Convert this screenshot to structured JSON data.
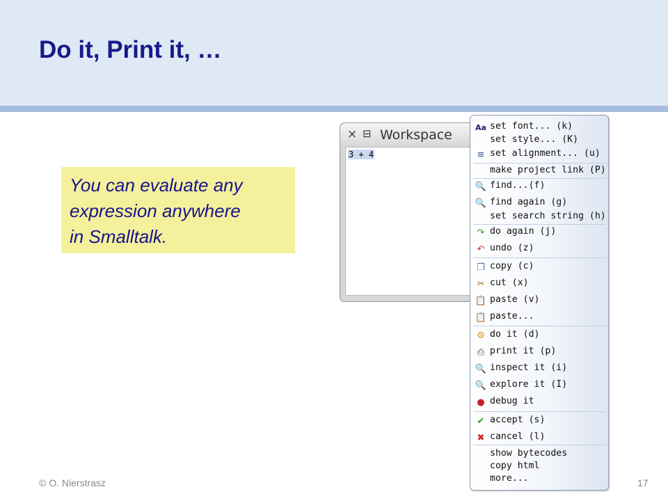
{
  "slide": {
    "title": "Do it, Print it, …",
    "callout": [
      "You can evaluate any",
      "expression anywhere",
      "in Smalltalk."
    ],
    "footer_left": "© O. Nierstrasz",
    "page_number": "17"
  },
  "workspace": {
    "close_glyph": "×",
    "menu_glyph": "⊟",
    "title": "Workspace",
    "code": "3 + 4"
  },
  "menu": {
    "items": [
      {
        "label": "set font... (k)",
        "icon": "font-icon"
      },
      {
        "label": "set style... (K)",
        "icon": ""
      },
      {
        "label": "set alignment... (u)",
        "icon": "align-icon"
      },
      {
        "label": "make project link (P)",
        "icon": ""
      },
      {
        "label": "find...(f)",
        "icon": "find-icon"
      },
      {
        "label": "find again (g)",
        "icon": "find-icon"
      },
      {
        "label": "set search string (h)",
        "icon": ""
      },
      {
        "label": "do again (j)",
        "icon": "redo-icon"
      },
      {
        "label": "undo (z)",
        "icon": "undo-icon"
      },
      {
        "label": "copy (c)",
        "icon": "copy-icon"
      },
      {
        "label": "cut (x)",
        "icon": "scissors-icon"
      },
      {
        "label": "paste (v)",
        "icon": "clipboard-icon"
      },
      {
        "label": "paste...",
        "icon": "clipboard-icon"
      },
      {
        "label": "do it (d)",
        "icon": "gear-icon"
      },
      {
        "label": "print it (p)",
        "icon": "printer-icon"
      },
      {
        "label": "inspect it (i)",
        "icon": "magnifier-icon"
      },
      {
        "label": "explore it (I)",
        "icon": "magnifier-icon"
      },
      {
        "label": "debug it",
        "icon": "bug-icon"
      },
      {
        "label": "accept (s)",
        "icon": "checkmark-icon"
      },
      {
        "label": "cancel (l)",
        "icon": "cross-icon"
      },
      {
        "label": "show bytecodes",
        "icon": ""
      },
      {
        "label": "copy html",
        "icon": ""
      },
      {
        "label": "more...",
        "icon": ""
      }
    ]
  },
  "icon_glyphs": {
    "font-icon": "Aa",
    "align-icon": "≡",
    "find-icon": "🔍",
    "redo-icon": "↷",
    "undo-icon": "↶",
    "copy-icon": "❐",
    "scissors-icon": "✂",
    "clipboard-icon": "📋",
    "gear-icon": "⚙",
    "printer-icon": "⎙",
    "magnifier-icon": "🔍",
    "bug-icon": "●",
    "checkmark-icon": "✔",
    "cross-icon": "✖"
  },
  "colors": {
    "title": "#161a88",
    "callout_bg": "#f5f09c",
    "header_bg": "#dfe8f5",
    "header_rule": "#a6bcdc"
  }
}
